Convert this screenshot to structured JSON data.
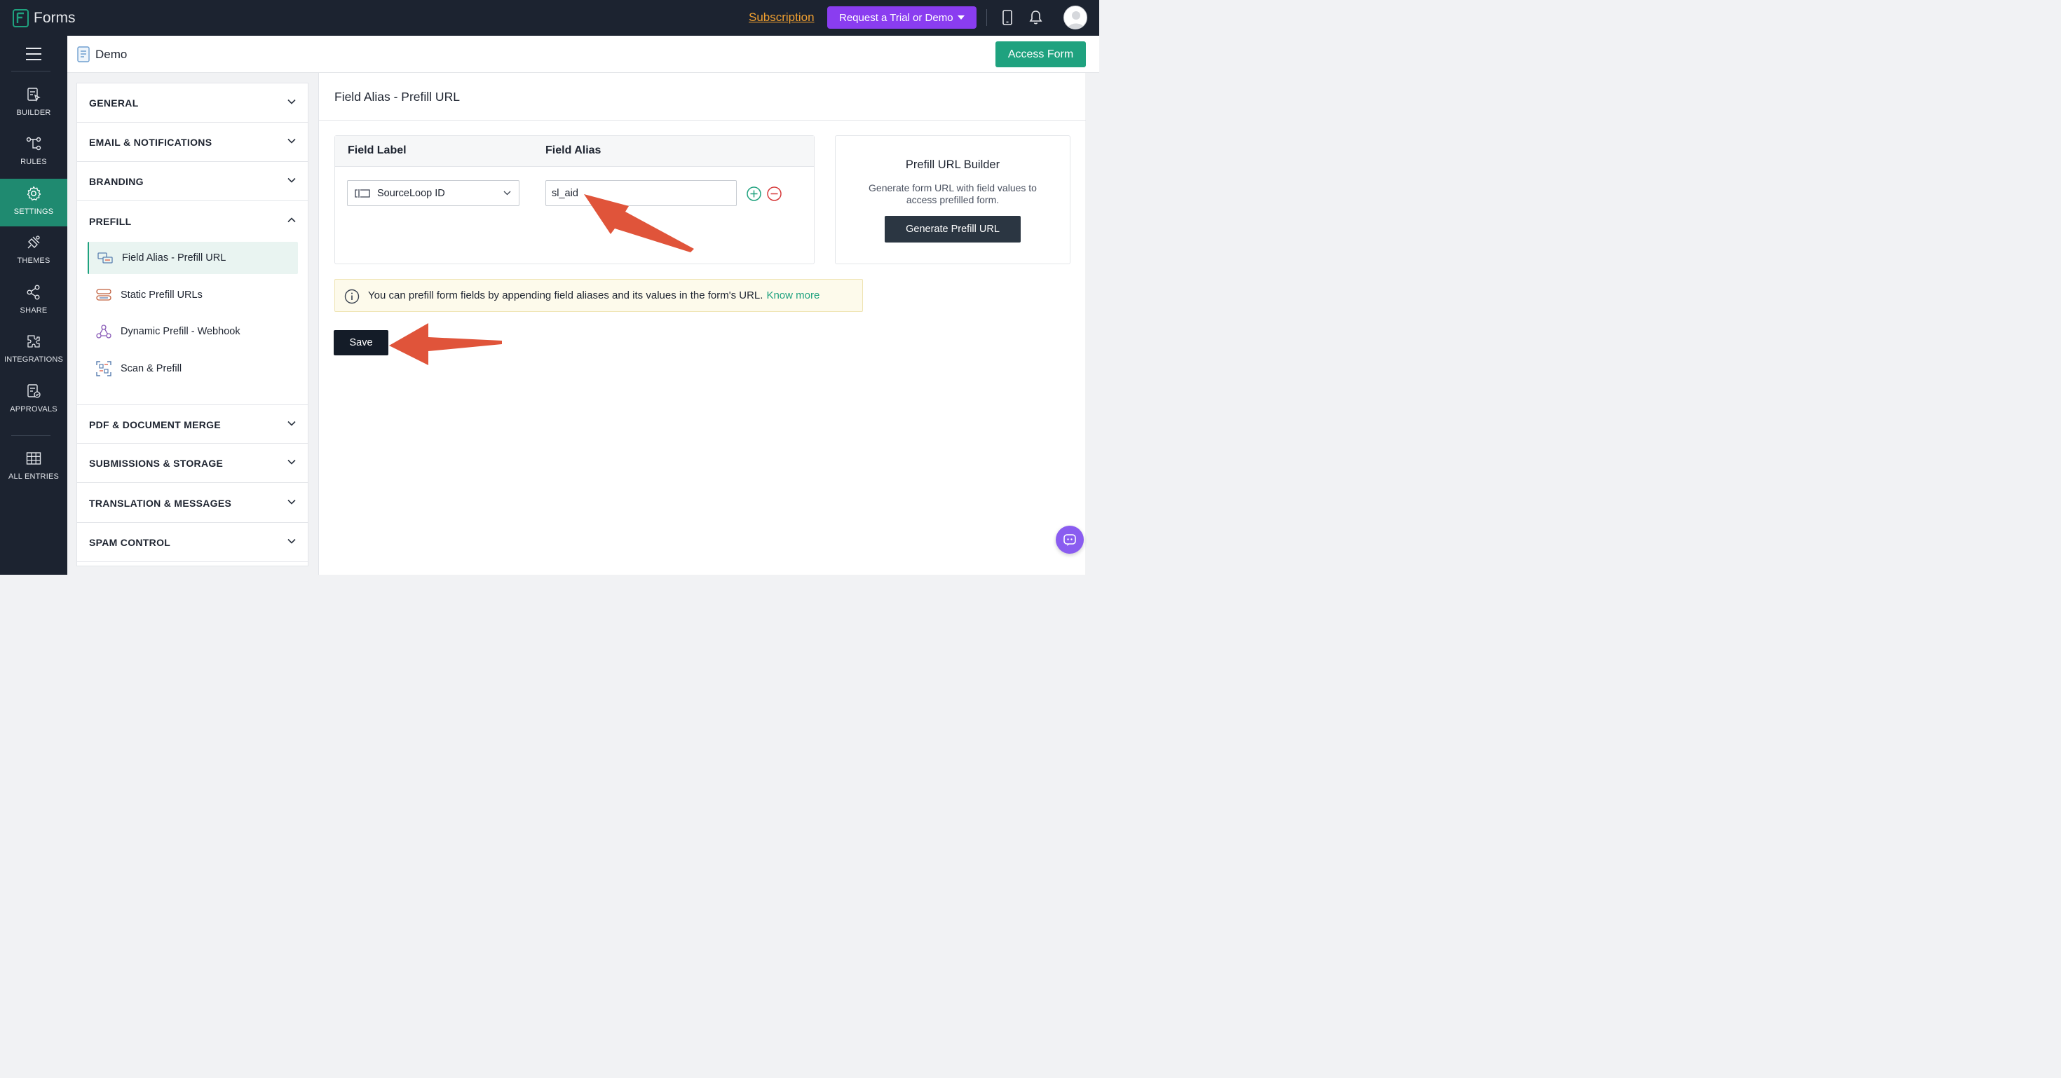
{
  "app": {
    "title": "Forms"
  },
  "topbar": {
    "subscription_label": "Subscription",
    "trial_button_label": "Request a Trial or Demo"
  },
  "leftnav": {
    "items": [
      {
        "label": "BUILDER",
        "icon": "builder-icon"
      },
      {
        "label": "RULES",
        "icon": "rules-icon"
      },
      {
        "label": "SETTINGS",
        "icon": "gear-icon",
        "active": true
      },
      {
        "label": "THEMES",
        "icon": "themes-icon"
      },
      {
        "label": "SHARE",
        "icon": "share-icon"
      },
      {
        "label": "INTEGRATIONS",
        "icon": "integrations-icon"
      },
      {
        "label": "APPROVALS",
        "icon": "approvals-icon"
      },
      {
        "label": "ALL ENTRIES",
        "icon": "table-icon"
      }
    ]
  },
  "header": {
    "form_name": "Demo",
    "access_button_label": "Access Form"
  },
  "settings": {
    "sections": [
      "GENERAL",
      "EMAIL & NOTIFICATIONS",
      "BRANDING",
      "PREFILL",
      "PDF & DOCUMENT MERGE",
      "SUBMISSIONS & STORAGE",
      "TRANSLATION & MESSAGES",
      "SPAM CONTROL"
    ],
    "prefill_items": [
      {
        "label": "Field Alias - Prefill URL",
        "icon": "field-alias-icon",
        "active": true
      },
      {
        "label": "Static Prefill URLs",
        "icon": "static-prefill-icon"
      },
      {
        "label": "Dynamic Prefill - Webhook",
        "icon": "webhook-icon"
      },
      {
        "label": "Scan & Prefill",
        "icon": "scan-icon"
      }
    ]
  },
  "main": {
    "title": "Field Alias - Prefill URL",
    "table": {
      "col_label": "Field Label",
      "col_alias": "Field Alias",
      "rows": [
        {
          "field": "SourceLoop ID",
          "alias": "sl_aid"
        }
      ]
    },
    "builder": {
      "title": "Prefill URL Builder",
      "description": "Generate form URL with field values to access prefilled form.",
      "button_label": "Generate Prefill URL"
    },
    "info": {
      "text": "You can prefill form fields by appending field aliases and its values in the form's URL.",
      "link": "Know more"
    },
    "save_label": "Save"
  },
  "colors": {
    "topbar": "#1c2330",
    "accent_green": "#1fa27f",
    "trial_purple": "#8a3df0",
    "annotation_arrow": "#e0543a"
  }
}
